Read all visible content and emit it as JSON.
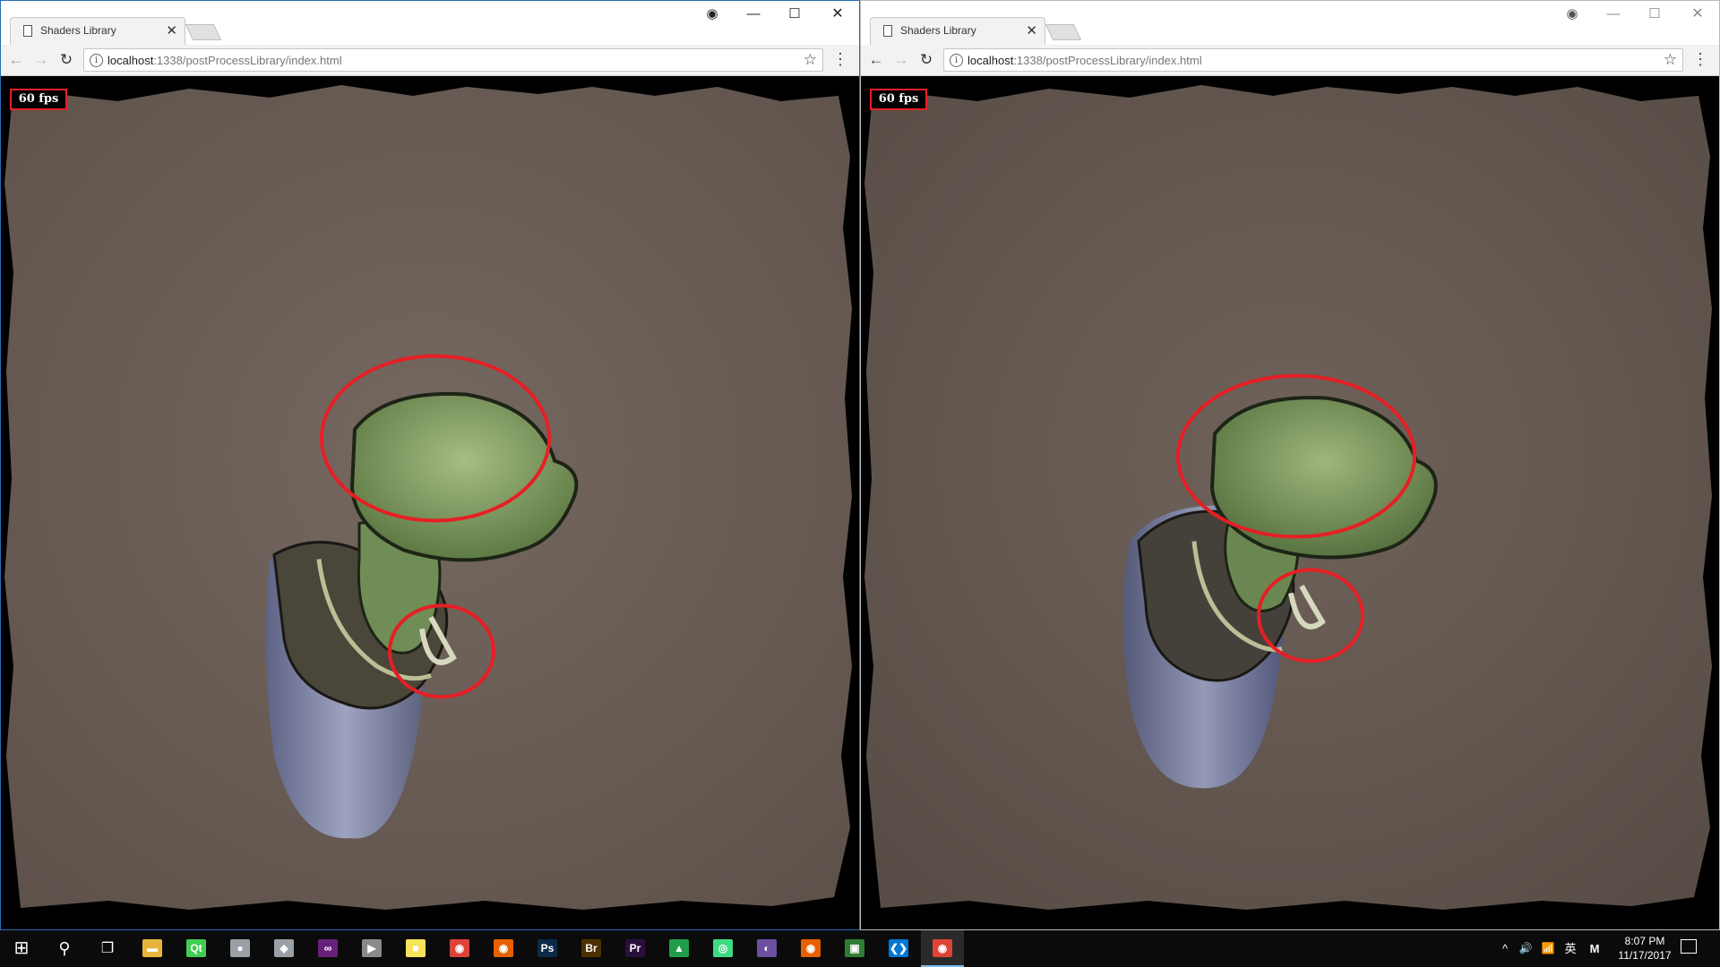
{
  "browser_windows": [
    {
      "tab": {
        "title": "Shaders Library",
        "close": "✕"
      },
      "url": {
        "host": "localhost",
        "path": ":1338/postProcessLibrary/index.html"
      },
      "window_controls": {
        "profile": "◉",
        "minimize": "—",
        "maximize": "☐",
        "close": "✕"
      },
      "nav": {
        "back": "←",
        "forward": "→",
        "reload": "↻",
        "info": "i",
        "bookmark": "☆",
        "menu": "⋮"
      },
      "fps": "60 fps"
    },
    {
      "tab": {
        "title": "Shaders Library",
        "close": "✕"
      },
      "url": {
        "host": "localhost",
        "path": ":1338/postProcessLibrary/index.html"
      },
      "window_controls": {
        "profile": "◉",
        "minimize": "—",
        "maximize": "☐",
        "close": "✕"
      },
      "nav": {
        "back": "←",
        "forward": "→",
        "reload": "↻",
        "info": "i",
        "bookmark": "☆",
        "menu": "⋮"
      },
      "fps": "60 fps"
    }
  ],
  "colors": {
    "highlight": "#e61f25",
    "paper": "#6b5d54",
    "head": "#7d9a5c",
    "cloth": "#494538",
    "pillar": "#7a7f9e"
  },
  "taskbar": {
    "start": "⊞",
    "search": "⚲",
    "task_view": "❐",
    "apps": [
      {
        "name": "file-explorer",
        "glyph": "▬",
        "color": "#e8b53c"
      },
      {
        "name": "qt-creator",
        "glyph": "Qt",
        "color": "#41cd52"
      },
      {
        "name": "app-3",
        "glyph": "●",
        "color": "#9aa0a6"
      },
      {
        "name": "app-4",
        "glyph": "◈",
        "color": "#9aa0a6"
      },
      {
        "name": "visual-studio",
        "glyph": "∞",
        "color": "#68217a"
      },
      {
        "name": "media-player",
        "glyph": "▶",
        "color": "#8a8a8a"
      },
      {
        "name": "sticky-notes",
        "glyph": "■",
        "color": "#f7e25b"
      },
      {
        "name": "chrome",
        "glyph": "◉",
        "color": "#db4437"
      },
      {
        "name": "firefox",
        "glyph": "◉",
        "color": "#e66000"
      },
      {
        "name": "photoshop",
        "glyph": "Ps",
        "color": "#0c2a4a"
      },
      {
        "name": "bridge",
        "glyph": "Br",
        "color": "#4a3200"
      },
      {
        "name": "premiere",
        "glyph": "Pr",
        "color": "#2a0f3c"
      },
      {
        "name": "app-13",
        "glyph": "▲",
        "color": "#1e9e4a"
      },
      {
        "name": "android-studio",
        "glyph": "◎",
        "color": "#3ddc84"
      },
      {
        "name": "eclipse",
        "glyph": "◐",
        "color": "#6c4fa0"
      },
      {
        "name": "firefox-2",
        "glyph": "◉",
        "color": "#e66000"
      },
      {
        "name": "app-17",
        "glyph": "▣",
        "color": "#2e7d32"
      },
      {
        "name": "vscode",
        "glyph": "❮❯",
        "color": "#0078d4"
      },
      {
        "name": "chrome-2",
        "glyph": "◉",
        "color": "#db4437",
        "active": true
      }
    ],
    "tray": {
      "chevron": "^",
      "volume": "🔊",
      "network": "📶",
      "ime": "英",
      "ime_mode": "M"
    },
    "clock": {
      "time": "8:07 PM",
      "date": "11/17/2017"
    }
  }
}
